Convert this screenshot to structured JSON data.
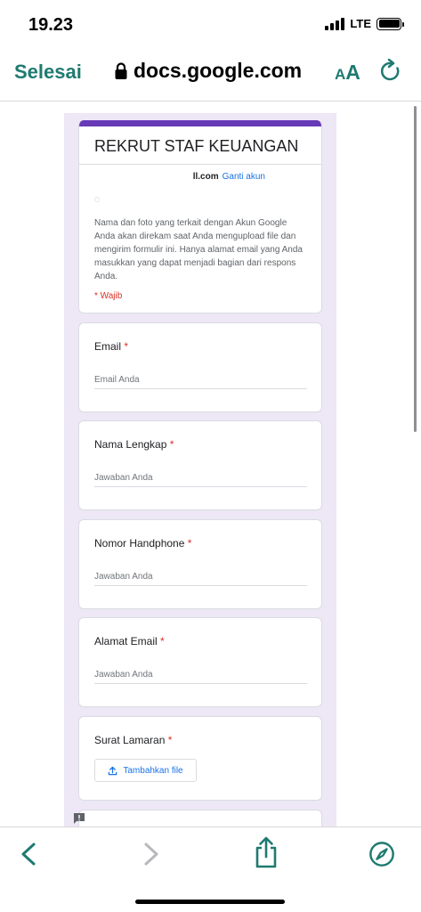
{
  "status_bar": {
    "time": "19.23",
    "network": "LTE",
    "signal_bars": 4,
    "battery_level": 1.0
  },
  "browser": {
    "done_label": "Selesai",
    "url": "docs.google.com",
    "text_size_small": "A",
    "text_size_big": "A",
    "icons": [
      "lock-icon",
      "reload-icon",
      "back-icon",
      "forward-icon",
      "share-icon",
      "compass-icon"
    ],
    "accent_color": "#1f7a70"
  },
  "form": {
    "title": "REKRUT STAF KEUANGAN",
    "theme_color": "#673ab7",
    "background_color": "#ede7f6",
    "account_email_partial": "ll.com",
    "switch_account": "Ganti akun",
    "notice": "Nama dan foto yang terkait dengan Akun Google Anda akan direkam saat Anda mengupload file dan mengirim formulir ini. Hanya alamat email yang Anda masukkan yang dapat menjadi bagian dari respons Anda.",
    "required_note": "* Wajib",
    "questions": [
      {
        "label": "Email",
        "required_mark": "*",
        "placeholder": "Email Anda"
      },
      {
        "label": "Nama Lengkap",
        "required_mark": "*",
        "placeholder": "Jawaban Anda"
      },
      {
        "label": "Nomor Handphone",
        "required_mark": "*",
        "placeholder": "Jawaban Anda"
      },
      {
        "label": "Alamat Email",
        "required_mark": "*",
        "placeholder": "Jawaban Anda"
      },
      {
        "label": "Surat Lamaran",
        "required_mark": "*",
        "button_label": "Tambahkan file"
      }
    ]
  }
}
